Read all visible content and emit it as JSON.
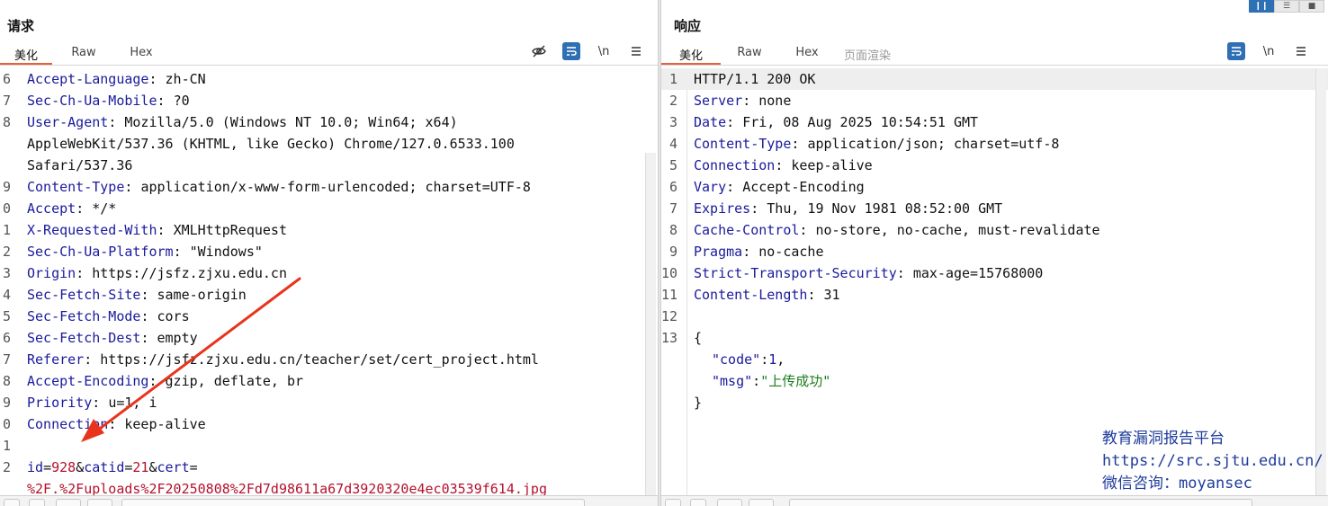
{
  "request": {
    "title": "请求",
    "tabs": [
      "美化",
      "Raw",
      "Hex"
    ],
    "active_tab": "美化",
    "toolbar": {
      "hide_icon": "eye-slash-icon",
      "wrap_icon": "wrap-lines-icon",
      "newline_label": "\\n",
      "menu_icon": "menu-icon"
    },
    "lines": [
      {
        "n": "6",
        "key": "Accept-Language",
        "sep": ": ",
        "val": "zh-CN"
      },
      {
        "n": "7",
        "key": "Sec-Ch-Ua-Mobile",
        "sep": ": ",
        "val": "?0"
      },
      {
        "n": "8",
        "key": "User-Agent",
        "sep": ": ",
        "val": "Mozilla/5.0 (Windows NT 10.0; Win64; x64)"
      },
      {
        "n": "",
        "key": "",
        "sep": "",
        "val": "AppleWebKit/537.36 (KHTML, like Gecko) Chrome/127.0.6533.100"
      },
      {
        "n": "",
        "key": "",
        "sep": "",
        "val": "Safari/537.36"
      },
      {
        "n": "9",
        "key": "Content-Type",
        "sep": ": ",
        "val": "application/x-www-form-urlencoded; charset=UTF-8"
      },
      {
        "n": "0",
        "key": "Accept",
        "sep": ": ",
        "val": "*/*"
      },
      {
        "n": "1",
        "key": "X-Requested-With",
        "sep": ": ",
        "val": "XMLHttpRequest"
      },
      {
        "n": "2",
        "key": "Sec-Ch-Ua-Platform",
        "sep": ": ",
        "val": "\"Windows\""
      },
      {
        "n": "3",
        "key": "Origin",
        "sep": ": ",
        "val": "https://jsfz.zjxu.edu.cn"
      },
      {
        "n": "4",
        "key": "Sec-Fetch-Site",
        "sep": ": ",
        "val": "same-origin"
      },
      {
        "n": "5",
        "key": "Sec-Fetch-Mode",
        "sep": ": ",
        "val": "cors"
      },
      {
        "n": "6",
        "key": "Sec-Fetch-Dest",
        "sep": ": ",
        "val": "empty"
      },
      {
        "n": "7",
        "key": "Referer",
        "sep": ": ",
        "val": "https://jsfz.zjxu.edu.cn/teacher/set/cert_project.html"
      },
      {
        "n": "8",
        "key": "Accept-Encoding",
        "sep": ": ",
        "val": "gzip, deflate, br"
      },
      {
        "n": "9",
        "key": "Priority",
        "sep": ": ",
        "val": "u=1, i"
      },
      {
        "n": "0",
        "key": "Connection",
        "sep": ": ",
        "val": "keep-alive"
      },
      {
        "n": "1",
        "key": "",
        "sep": "",
        "val": ""
      }
    ],
    "body_line_number": "2",
    "body_params": [
      {
        "k": "id",
        "v": "928"
      },
      {
        "k": "catid",
        "v": "21"
      },
      {
        "k": "cert",
        "v": ""
      }
    ],
    "body_continuation": "%2F.%2Fuploads%2F20250808%2Fd7d98611a67d3920320e4ec03539f614.jpg"
  },
  "response": {
    "title": "响应",
    "tabs": [
      "美化",
      "Raw",
      "Hex",
      "页面渲染"
    ],
    "active_tab": "美化",
    "toolbar": {
      "wrap_icon": "wrap-lines-icon",
      "newline_label": "\\n",
      "menu_icon": "menu-icon"
    },
    "status_line": "HTTP/1.1 200 OK",
    "headers": [
      {
        "n": "2",
        "key": "Server",
        "val": "none"
      },
      {
        "n": "3",
        "key": "Date",
        "val": "Fri, 08 Aug 2025 10:54:51 GMT"
      },
      {
        "n": "4",
        "key": "Content-Type",
        "val": "application/json; charset=utf-8"
      },
      {
        "n": "5",
        "key": "Connection",
        "val": "keep-alive"
      },
      {
        "n": "6",
        "key": "Vary",
        "val": "Accept-Encoding"
      },
      {
        "n": "7",
        "key": "Expires",
        "val": "Thu, 19 Nov 1981 08:52:00 GMT"
      },
      {
        "n": "8",
        "key": "Cache-Control",
        "val": "no-store, no-cache, must-revalidate"
      },
      {
        "n": "9",
        "key": "Pragma",
        "val": "no-cache"
      },
      {
        "n": "10",
        "key": "Strict-Transport-Security",
        "val": "max-age=15768000"
      },
      {
        "n": "11",
        "key": "Content-Length",
        "val": "31"
      }
    ],
    "empty_line_number": "12",
    "json_line_number": "13",
    "json": {
      "open": "{",
      "code_key": "\"code\"",
      "code_val": "1",
      "msg_key": "\"msg\"",
      "msg_val": "\"上传成功\"",
      "close": "}"
    }
  },
  "watermark": {
    "title": "教育漏洞报告平台",
    "url": "https://src.sjtu.edu.cn/",
    "contact": "微信咨询：moyansec"
  },
  "colors": {
    "accent": "#e8613c",
    "blue": "#2f6fb3",
    "arrow": "#e8341c"
  }
}
